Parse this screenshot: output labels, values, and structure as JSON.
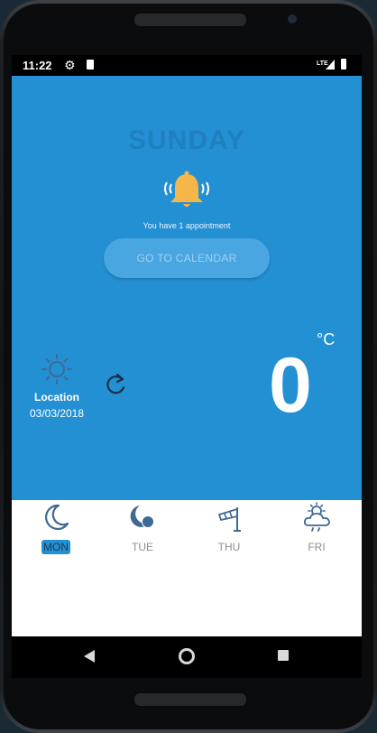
{
  "status": {
    "time": "11:22",
    "network": "LTE"
  },
  "main": {
    "day_name": "SUNDAY",
    "appointment_text": "You have 1 appointment",
    "calendar_button_label": "GO TO CALENDAR",
    "location_label": "Location",
    "date": "03/03/2018",
    "temperature": "0",
    "unit": "°C"
  },
  "forecast": [
    {
      "label": "MON",
      "icon": "moon-icon",
      "active": true
    },
    {
      "label": "TUE",
      "icon": "moon-cloud-icon",
      "active": false
    },
    {
      "label": "THU",
      "icon": "windsock-icon",
      "active": false
    },
    {
      "label": "FRI",
      "icon": "sun-cloud-rain-icon",
      "active": false
    }
  ],
  "colors": {
    "primary": "#2490d4",
    "button": "#4aa6e0",
    "bell": "#f6b64a",
    "icon": "#3f6a94",
    "inactive_label": "#8a8f94"
  }
}
